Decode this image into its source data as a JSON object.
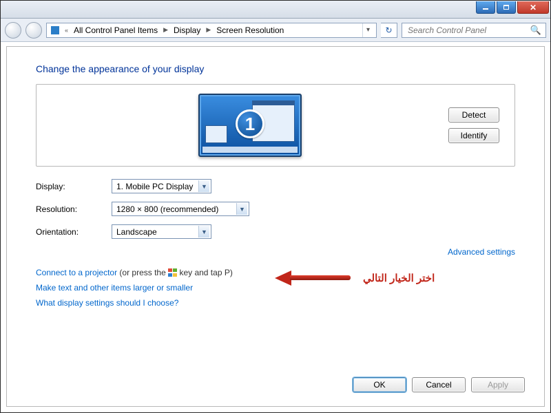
{
  "breadcrumbs": {
    "prefix": "«",
    "items": [
      "All Control Panel Items",
      "Display",
      "Screen Resolution"
    ]
  },
  "search": {
    "placeholder": "Search Control Panel"
  },
  "heading": "Change the appearance of your display",
  "monitor_number": "1",
  "buttons": {
    "detect": "Detect",
    "identify": "Identify",
    "ok": "OK",
    "cancel": "Cancel",
    "apply": "Apply"
  },
  "labels": {
    "display": "Display:",
    "resolution": "Resolution:",
    "orientation": "Orientation:"
  },
  "values": {
    "display": "1. Mobile PC Display",
    "resolution": "1280 × 800 (recommended)",
    "orientation": "Landscape"
  },
  "links": {
    "advanced": "Advanced settings",
    "projector": "Connect to a projector",
    "projector_hint_before": " (or press the ",
    "projector_hint_after": " key and tap P)",
    "larger_smaller": "Make text and other items larger or smaller",
    "which_settings": "What display settings should I choose?"
  },
  "annotation": "اختر الخيار التالي"
}
